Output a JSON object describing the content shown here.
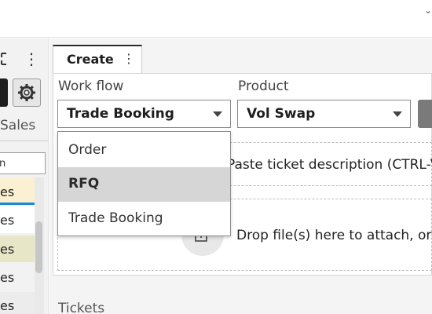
{
  "left_panel": {
    "sales_tab": "Sales",
    "filter_text": "n",
    "rows": [
      {
        "text": "es",
        "bg": "#fbf0d2"
      },
      {
        "text": "es",
        "bg": "#ffffff"
      },
      {
        "text": "es",
        "bg": "#e7e6c6"
      },
      {
        "text": "es",
        "bg": "#f2f2f2"
      },
      {
        "text": "es",
        "bg": "#ececec"
      }
    ]
  },
  "tab": {
    "label": "Create"
  },
  "form": {
    "workflow_label": "Work flow",
    "workflow_value": "Trade Booking",
    "product_label": "Product",
    "product_value": "Vol Swap",
    "paste_hint": "Paste ticket description (CTRL-V",
    "drop_hint": "Drop file(s) here to attach, or"
  },
  "dropdown": {
    "options": [
      "Order",
      "RFQ",
      "Trade Booking"
    ],
    "selected": "RFQ"
  },
  "tickets_label": "Tickets",
  "colors": {
    "selected_option_bg": "#d6d6d6",
    "highlight_row": "#fbf0d2",
    "active_underline": "#1e88d6"
  }
}
